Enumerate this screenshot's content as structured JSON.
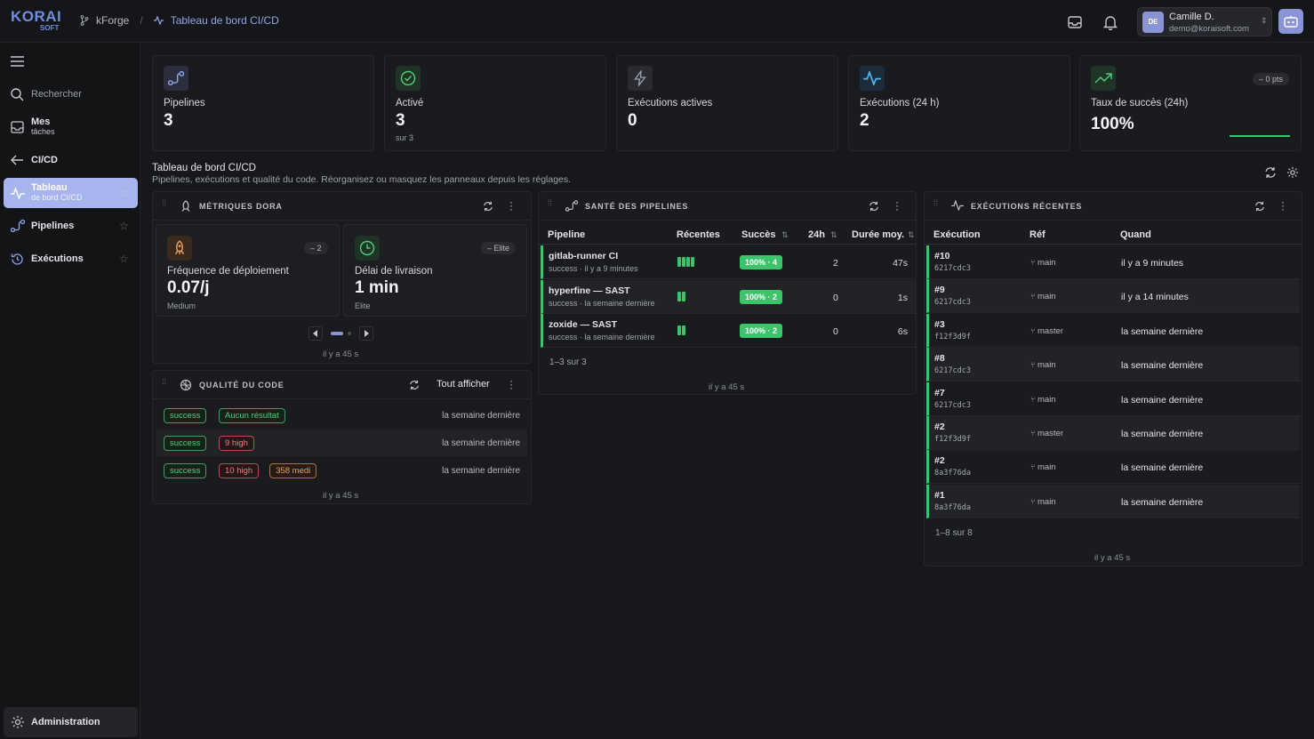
{
  "topbar": {
    "logo_main": "KORAI",
    "logo_sub": "SOFT",
    "breadcrumb_project": "kForge",
    "breadcrumb_sep": "/",
    "breadcrumb_current": "Tableau de bord CI/CD",
    "user_initials": "DE",
    "user_name": "Camille D.",
    "user_email": "demo@koraisoft.com"
  },
  "sidebar": {
    "search_placeholder": "Rechercher",
    "items": [
      {
        "label": "Mes",
        "sub": "tâches"
      },
      {
        "label": "CI/CD",
        "sub": ""
      },
      {
        "label": "Tableau",
        "sub": "de bord CI/CD"
      },
      {
        "label": "Pipelines",
        "sub": ""
      },
      {
        "label": "Exécutions",
        "sub": ""
      }
    ],
    "admin_label": "Administration",
    "brand": "kForge"
  },
  "stats": [
    {
      "label": "Pipelines",
      "value": "3",
      "sub": ""
    },
    {
      "label": "Activé",
      "value": "3",
      "sub": "sur 3"
    },
    {
      "label": "Exécutions actives",
      "value": "0",
      "sub": ""
    },
    {
      "label": "Exécutions (24 h)",
      "value": "2",
      "sub": ""
    },
    {
      "label": "Taux de succès (24h)",
      "value": "100%",
      "sub": "",
      "pill": "– 0 pts"
    }
  ],
  "section": {
    "title": "Tableau de bord CI/CD",
    "desc": "Pipelines, exécutions et qualité du code. Réorganisez ou masquez les panneaux depuis les réglages."
  },
  "dora": {
    "title": "MÉTRIQUES DORA",
    "cards": [
      {
        "label": "Fréquence de déploiement",
        "value": "0.07/j",
        "sub": "Medium",
        "pill": "– 2"
      },
      {
        "label": "Délai de livraison",
        "value": "1 min",
        "sub": "Elite",
        "pill": "– Elite"
      }
    ],
    "footer": "il y a 45 s"
  },
  "quality": {
    "title": "QUALITÉ DU CODE",
    "show_all": "Tout afficher",
    "rows": [
      {
        "status": "success",
        "tags": [
          {
            "text": "Aucun résultat",
            "kind": "green"
          }
        ],
        "when": "la semaine dernière"
      },
      {
        "status": "success",
        "tags": [
          {
            "text": "9 high",
            "kind": "red"
          }
        ],
        "when": "la semaine dernière"
      },
      {
        "status": "success",
        "tags": [
          {
            "text": "10 high",
            "kind": "red"
          },
          {
            "text": "358 medi",
            "kind": "orange"
          }
        ],
        "when": "la semaine dernière"
      }
    ],
    "footer": "il y a 45 s"
  },
  "health": {
    "title": "SANTÉ DES PIPELINES",
    "headers": [
      "Pipeline",
      "Récentes",
      "Succès",
      "24h",
      "Durée moy."
    ],
    "rows": [
      {
        "name": "gitlab-runner CI",
        "sub": "success · il y a 9 minutes",
        "recent": 4,
        "success": "100% · 4",
        "h24": "2",
        "dur": "47s"
      },
      {
        "name": "hyperfine — SAST",
        "sub": "success · la semaine dernière",
        "recent": 2,
        "success": "100% · 2",
        "h24": "0",
        "dur": "1s"
      },
      {
        "name": "zoxide — SAST",
        "sub": "success · la semaine dernière",
        "recent": 2,
        "success": "100% · 2",
        "h24": "0",
        "dur": "6s"
      }
    ],
    "count": "1–3 sur 3",
    "footer": "il y a 45 s"
  },
  "runs": {
    "title": "EXÉCUTIONS RÉCENTES",
    "headers": [
      "Exécution",
      "Réf",
      "Quand"
    ],
    "rows": [
      {
        "id": "#10",
        "sha": "6217cdc3",
        "ref": "main",
        "when": "il y a 9 minutes"
      },
      {
        "id": "#9",
        "sha": "6217cdc3",
        "ref": "main",
        "when": "il y a 14 minutes"
      },
      {
        "id": "#3",
        "sha": "f12f3d9f",
        "ref": "master",
        "when": "la semaine dernière"
      },
      {
        "id": "#8",
        "sha": "6217cdc3",
        "ref": "main",
        "when": "la semaine dernière"
      },
      {
        "id": "#7",
        "sha": "6217cdc3",
        "ref": "main",
        "when": "la semaine dernière"
      },
      {
        "id": "#2",
        "sha": "f12f3d9f",
        "ref": "master",
        "when": "la semaine dernière"
      },
      {
        "id": "#2",
        "sha": "8a3f76da",
        "ref": "main",
        "when": "la semaine dernière"
      },
      {
        "id": "#1",
        "sha": "8a3f76da",
        "ref": "main",
        "when": "la semaine dernière"
      }
    ],
    "count": "1–8 sur 8",
    "footer": "il y a 45 s"
  },
  "colors": {
    "accent": "#8a93d6",
    "success": "#3cc46a",
    "bg": "#17181b"
  }
}
